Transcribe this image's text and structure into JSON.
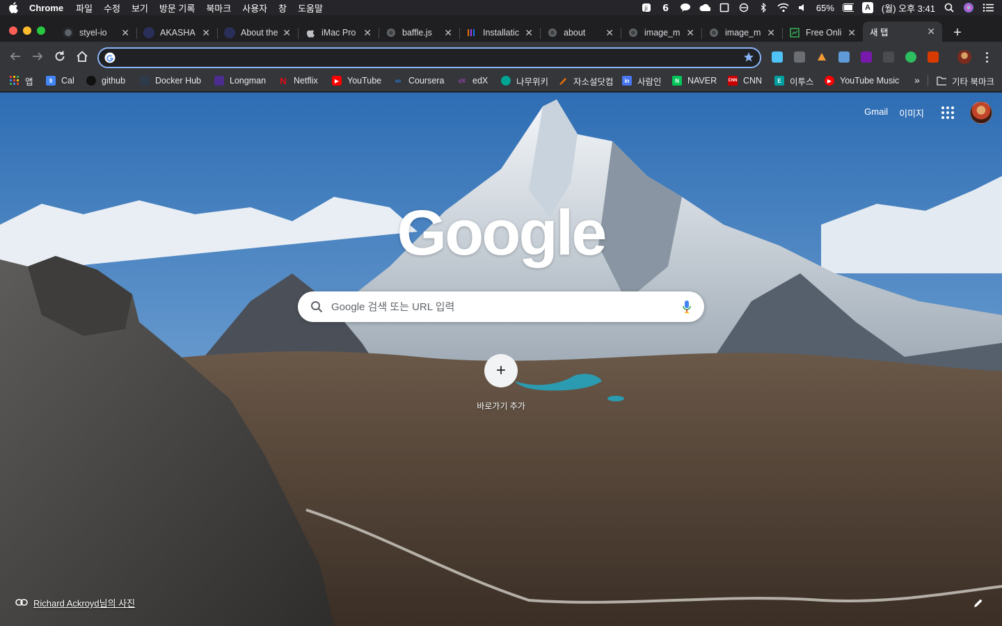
{
  "menubar": {
    "app_name": "Chrome",
    "menus": [
      "파일",
      "수정",
      "보기",
      "방문 기록",
      "북마크",
      "사용자",
      "창",
      "도움말"
    ],
    "battery": "65%",
    "input_source": "A",
    "clock": "(월) 오후 3:41"
  },
  "tabs": [
    {
      "title": "styel-io",
      "icon": "github-icon",
      "color": "#24292e"
    },
    {
      "title": "AKASHA",
      "icon": "akasha-icon",
      "color": "#2a2f5a"
    },
    {
      "title": "About the",
      "icon": "akasha-icon",
      "color": "#2a2f5a"
    },
    {
      "title": "iMac Pro",
      "icon": "apple-icon",
      "color": "#9aa0a6"
    },
    {
      "title": "baffle.js",
      "icon": "globe-icon",
      "color": "#5f6368"
    },
    {
      "title": "Installatic",
      "icon": "docs-icon",
      "color": "#e8710a"
    },
    {
      "title": "about",
      "icon": "globe-icon",
      "color": "#5f6368"
    },
    {
      "title": "image_m",
      "icon": "globe-icon",
      "color": "#5f6368"
    },
    {
      "title": "image_m",
      "icon": "globe-icon",
      "color": "#5f6368"
    },
    {
      "title": "Free Onli",
      "icon": "chart-icon",
      "color": "#1e8e3e"
    },
    {
      "title": "새 탭",
      "icon": "",
      "color": "",
      "active": true
    }
  ],
  "toolbar": {
    "omnibox_value": "",
    "extensions": [
      "cloud-ext",
      "extension-ext",
      "ipfs-ext",
      "window-ext",
      "onenote-ext",
      "shield-ext",
      "evernote-ext",
      "office-ext"
    ]
  },
  "bookmarks": {
    "items": [
      {
        "label": "앱",
        "color": "#4285f4"
      },
      {
        "label": "Cal",
        "color": "#1a73e8"
      },
      {
        "label": "github",
        "color": "#24292e"
      },
      {
        "label": "Docker Hub",
        "color": "#2496ed"
      },
      {
        "label": "Longman",
        "color": "#4b2d8f"
      },
      {
        "label": "Netflix",
        "color": "#e50914"
      },
      {
        "label": "YouTube",
        "color": "#ff0000"
      },
      {
        "label": "Coursera",
        "color": "#2a73cc"
      },
      {
        "label": "edX",
        "color": "#02262b"
      },
      {
        "label": "나무위키",
        "color": "#00a495"
      },
      {
        "label": "자소설닷컴",
        "color": "#e8710a"
      },
      {
        "label": "사람인",
        "color": "#4876ef"
      },
      {
        "label": "NAVER",
        "color": "#03c75a"
      },
      {
        "label": "CNN",
        "color": "#cc0000"
      },
      {
        "label": "이투스",
        "color": "#00a0a0"
      },
      {
        "label": "YouTube Music",
        "color": "#ff0000"
      }
    ],
    "more": "»",
    "other_folder": "기타 북마크"
  },
  "ntp": {
    "gmail": "Gmail",
    "images": "이미지",
    "logo": "Google",
    "search_placeholder": "Google 검색 또는 URL 입력",
    "add_shortcut": "바로가기 추가",
    "photo_credit": "Richard Ackroyd님의 사진"
  }
}
